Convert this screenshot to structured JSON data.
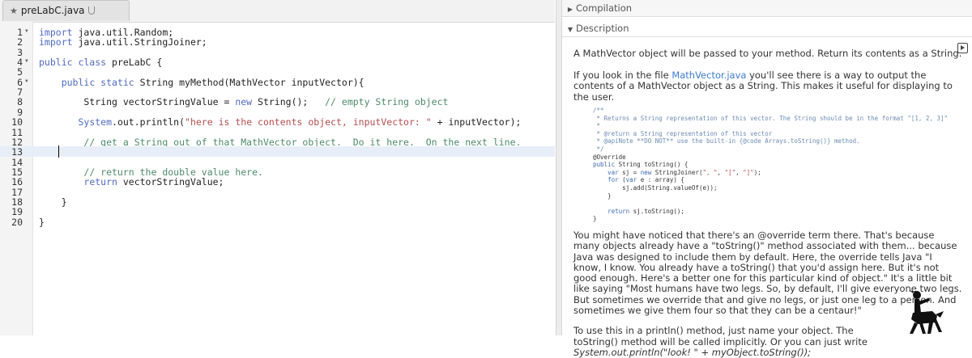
{
  "editor": {
    "tab": {
      "star": "★",
      "filename": "preLabC.java"
    },
    "active_line": 13,
    "lines": [
      {
        "n": "1",
        "fold": true,
        "tokens": [
          [
            "kw",
            "import"
          ],
          [
            "",
            " java.util.Random;"
          ]
        ]
      },
      {
        "n": "2",
        "fold": false,
        "tokens": [
          [
            "kw",
            "import"
          ],
          [
            "",
            " java.util.StringJoiner;"
          ]
        ]
      },
      {
        "n": "3",
        "fold": false,
        "tokens": []
      },
      {
        "n": "4",
        "fold": true,
        "tokens": [
          [
            "kw",
            "public class"
          ],
          [
            "",
            " preLabC {"
          ]
        ]
      },
      {
        "n": "5",
        "fold": false,
        "tokens": []
      },
      {
        "n": "6",
        "fold": true,
        "tokens": [
          [
            "",
            "    "
          ],
          [
            "kw",
            "public static"
          ],
          [
            "",
            " String myMethod(MathVector inputVector){"
          ]
        ]
      },
      {
        "n": "7",
        "fold": false,
        "tokens": []
      },
      {
        "n": "8",
        "fold": false,
        "tokens": [
          [
            "",
            "        String vectorStringValue = "
          ],
          [
            "kw",
            "new"
          ],
          [
            "",
            " String();   "
          ],
          [
            "cm",
            "// empty String object"
          ]
        ]
      },
      {
        "n": "9",
        "fold": false,
        "tokens": []
      },
      {
        "n": "10",
        "fold": false,
        "tokens": [
          [
            "",
            "       "
          ],
          [
            "kw",
            "System"
          ],
          [
            "",
            ".out.println("
          ],
          [
            "str",
            "\"here is the contents object, inputVector: \""
          ],
          [
            "",
            " + inputVector);"
          ]
        ]
      },
      {
        "n": "11",
        "fold": false,
        "tokens": []
      },
      {
        "n": "12",
        "fold": false,
        "tokens": [
          [
            "",
            "        "
          ],
          [
            "cm",
            "// get a String out of that MathVector object.  Do it here.  On the next line."
          ]
        ]
      },
      {
        "n": "13",
        "fold": false,
        "tokens": []
      },
      {
        "n": "14",
        "fold": false,
        "tokens": []
      },
      {
        "n": "15",
        "fold": false,
        "tokens": [
          [
            "",
            "        "
          ],
          [
            "cm",
            "// return the double value here."
          ]
        ]
      },
      {
        "n": "16",
        "fold": false,
        "tokens": [
          [
            "",
            "        "
          ],
          [
            "kw",
            "return"
          ],
          [
            "",
            " vectorStringValue;"
          ]
        ]
      },
      {
        "n": "17",
        "fold": false,
        "tokens": []
      },
      {
        "n": "18",
        "fold": false,
        "tokens": [
          [
            "",
            "    }"
          ]
        ]
      },
      {
        "n": "19",
        "fold": false,
        "tokens": []
      },
      {
        "n": "20",
        "fold": false,
        "tokens": [
          [
            "",
            "}"
          ]
        ]
      }
    ]
  },
  "right": {
    "compilation_label": "Compilation",
    "description_label": "Description",
    "p1": "A MathVector object will be passed to your method.  Return its contents as a String.",
    "p2_a": "If you look in the file ",
    "p2_link": "MathVector.java",
    "p2_b": " you'll see there is a way to output the contents of a MathVector object as a String.  This makes it useful for displaying to the user.",
    "code": [
      [
        [
          "jdoc",
          "/**"
        ]
      ],
      [
        [
          "jdoc",
          " * Returns a String representation of this vector. The String should be in the format \"[1, 2, 3]\""
        ]
      ],
      [
        [
          "jdoc",
          " *"
        ]
      ],
      [
        [
          "jdoc",
          " * @return a String representation of this vector"
        ]
      ],
      [
        [
          "jdoc",
          " * @apiNote **DO NOT** use the built-in {@code Arrays.toString()} method."
        ]
      ],
      [
        [
          "jdoc",
          " */"
        ]
      ],
      [
        [
          "",
          "@Override"
        ]
      ],
      [
        [
          "jkw",
          "public"
        ],
        [
          "",
          " String toString() {"
        ]
      ],
      [
        [
          "",
          "    "
        ],
        [
          "jkw",
          "var"
        ],
        [
          "",
          " sj = "
        ],
        [
          "jkw",
          "new"
        ],
        [
          "",
          " StringJoiner("
        ],
        [
          "jstr",
          "\", \""
        ],
        [
          "",
          ", "
        ],
        [
          "jstr",
          "\"[\""
        ],
        [
          "",
          ", "
        ],
        [
          "jstr",
          "\"]\""
        ],
        [
          "",
          ");"
        ]
      ],
      [
        [
          "",
          "    "
        ],
        [
          "jkw",
          "for"
        ],
        [
          "",
          " ("
        ],
        [
          "jkw",
          "var"
        ],
        [
          "",
          " e : array) {"
        ]
      ],
      [
        [
          "",
          "        sj.add(String.valueOf(e));"
        ]
      ],
      [
        [
          "",
          "    }"
        ]
      ],
      [
        [
          "",
          ""
        ]
      ],
      [
        [
          "",
          "    "
        ],
        [
          "jkw",
          "return"
        ],
        [
          "",
          " sj.toString();"
        ]
      ],
      [
        [
          "",
          "}"
        ]
      ]
    ],
    "p3": "You might have noticed that there's an @override term there.  That's because many objects already have a \"toString()\" method associated with them... because Java was designed to include them by default.  Here, the override tells Java \"I know, I know.  You already have a toString() that you'd assign here.  But it's not good enough.  Here's a better one for this particular kind of object.\"  It's a little bit like saying \"Most humans have two legs.  So, by default, I'll give everyone two legs.  But sometimes we override that and give no legs, or just one leg to a person.  And sometimes we give them four so that they can be a centaur!\"",
    "p4_a": "To use this in a println() method, just name your object.  The toString() method will be called implicitly.  Or you can just write",
    "p4_code": "System.out.println(\"look! \" + myObject.toString());"
  }
}
